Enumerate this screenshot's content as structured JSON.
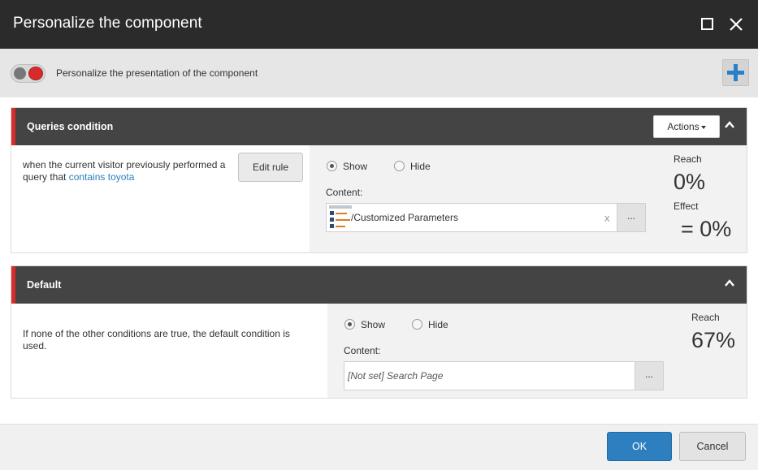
{
  "dialog": {
    "title": "Personalize the component"
  },
  "toolbar": {
    "toggle_label": "Personalize the presentation of the component",
    "toggle_on": false
  },
  "conditions": [
    {
      "title": "Queries condition",
      "actions_label": "Actions",
      "rule_text": "when the current visitor previously performed a query that ",
      "rule_link": "contains toyota",
      "edit_rule_label": "Edit rule",
      "show_label": "Show",
      "hide_label": "Hide",
      "selected": "show",
      "content_label": "Content:",
      "content_value": "/Customized Parameters",
      "clear_label": "x",
      "browse_label": "...",
      "reach_label": "Reach",
      "reach_value": "0%",
      "effect_label": "Effect",
      "effect_value": "= 0%"
    },
    {
      "title": "Default",
      "rule_text": "If none of the other conditions are true, the default condition is used.",
      "show_label": "Show",
      "hide_label": "Hide",
      "selected": "show",
      "content_label": "Content:",
      "content_value": "[Not set] Search Page",
      "browse_label": "...",
      "reach_label": "Reach",
      "reach_value": "67%"
    }
  ],
  "footer": {
    "ok_label": "OK",
    "cancel_label": "Cancel"
  },
  "colors": {
    "titlebar": "#2b2b2b",
    "accent_red": "#d92b2b",
    "panel_header": "#444444",
    "primary_blue": "#2d7fbf",
    "link_blue": "#2980b9"
  }
}
